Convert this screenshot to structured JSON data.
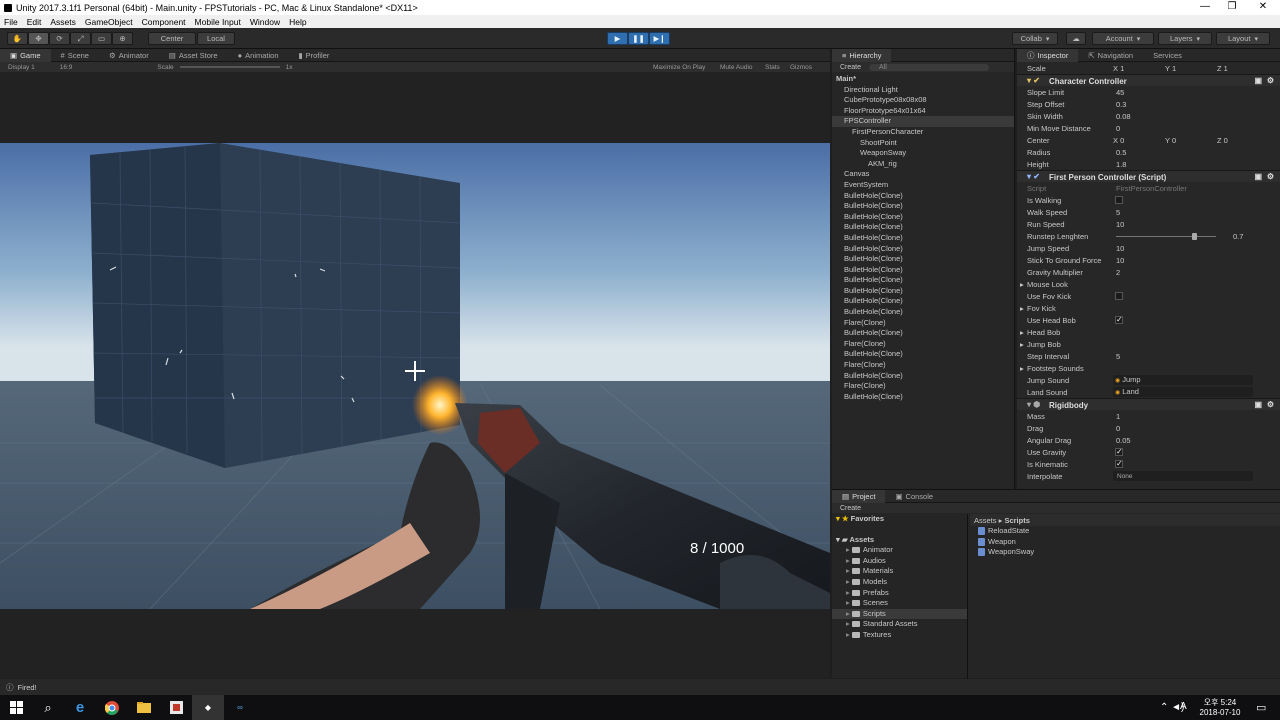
{
  "window": {
    "title": "Unity 2017.3.1f1 Personal (64bit) - Main.unity - FPSTutorials - PC, Mac & Linux Standalone* <DX11>",
    "controls": [
      "—",
      "❐",
      "✕"
    ]
  },
  "menu": [
    "File",
    "Edit",
    "Assets",
    "GameObject",
    "Component",
    "Mobile Input",
    "Window",
    "Help"
  ],
  "toolbar": {
    "pivot": "Center",
    "space": "Local",
    "collab": "Collab",
    "account": "Account",
    "layers": "Layers",
    "layout": "Layout"
  },
  "scene_tabs": [
    "Game",
    "Scene",
    "Animator",
    "Asset Store",
    "Animation",
    "Profiler"
  ],
  "gamebar": {
    "display": "Display 1",
    "aspect": "16:9",
    "scale_label": "Scale",
    "scale_value": "1x",
    "options": [
      "Maximize On Play",
      "Mute Audio",
      "Stats",
      "Gizmos"
    ]
  },
  "game": {
    "ammo": "8 / 1000"
  },
  "hierarchy": {
    "tab": "Hierarchy",
    "create": "Create",
    "search": "All",
    "items": [
      {
        "label": "Main*",
        "indent": 0,
        "bold": true
      },
      {
        "label": "Directional Light",
        "indent": 1
      },
      {
        "label": "CubePrototype08x08x08",
        "indent": 1
      },
      {
        "label": "FloorPrototype64x01x64",
        "indent": 1
      },
      {
        "label": "FPSController",
        "indent": 1,
        "selected": true
      },
      {
        "label": "FirstPersonCharacter",
        "indent": 2
      },
      {
        "label": "ShootPoint",
        "indent": 3
      },
      {
        "label": "WeaponSway",
        "indent": 3
      },
      {
        "label": "AKM_rig",
        "indent": 4
      },
      {
        "label": "Canvas",
        "indent": 1
      },
      {
        "label": "EventSystem",
        "indent": 1
      },
      {
        "label": "BulletHole(Clone)",
        "indent": 1
      },
      {
        "label": "BulletHole(Clone)",
        "indent": 1
      },
      {
        "label": "BulletHole(Clone)",
        "indent": 1
      },
      {
        "label": "BulletHole(Clone)",
        "indent": 1
      },
      {
        "label": "BulletHole(Clone)",
        "indent": 1
      },
      {
        "label": "BulletHole(Clone)",
        "indent": 1
      },
      {
        "label": "BulletHole(Clone)",
        "indent": 1
      },
      {
        "label": "BulletHole(Clone)",
        "indent": 1
      },
      {
        "label": "BulletHole(Clone)",
        "indent": 1
      },
      {
        "label": "BulletHole(Clone)",
        "indent": 1
      },
      {
        "label": "BulletHole(Clone)",
        "indent": 1
      },
      {
        "label": "BulletHole(Clone)",
        "indent": 1
      },
      {
        "label": "Flare(Clone)",
        "indent": 1
      },
      {
        "label": "BulletHole(Clone)",
        "indent": 1
      },
      {
        "label": "Flare(Clone)",
        "indent": 1
      },
      {
        "label": "BulletHole(Clone)",
        "indent": 1
      },
      {
        "label": "Flare(Clone)",
        "indent": 1
      },
      {
        "label": "BulletHole(Clone)",
        "indent": 1
      },
      {
        "label": "Flare(Clone)",
        "indent": 1
      },
      {
        "label": "BulletHole(Clone)",
        "indent": 1
      }
    ]
  },
  "inspector": {
    "tabs": [
      "Inspector",
      "Navigation",
      "Services"
    ],
    "scale": {
      "label": "Scale",
      "x": "1",
      "y": "1",
      "z": "1"
    },
    "character_controller": {
      "title": "Character Controller",
      "rows": [
        {
          "label": "Slope Limit",
          "value": "45"
        },
        {
          "label": "Step Offset",
          "value": "0.3"
        },
        {
          "label": "Skin Width",
          "value": "0.08"
        },
        {
          "label": "Min Move Distance",
          "value": "0"
        }
      ],
      "center": {
        "label": "Center",
        "x": "0",
        "y": "0",
        "z": "0"
      },
      "rows2": [
        {
          "label": "Radius",
          "value": "0.5"
        },
        {
          "label": "Height",
          "value": "1.8"
        }
      ]
    },
    "fpc": {
      "title": "First Person Controller (Script)",
      "script_label": "Script",
      "script_value": "FirstPersonController",
      "rows": [
        {
          "label": "Is Walking",
          "type": "check",
          "checked": false
        },
        {
          "label": "Walk Speed",
          "value": "5"
        },
        {
          "label": "Run Speed",
          "value": "10"
        },
        {
          "label": "Runstep Lenghten",
          "value": "0.7",
          "type": "slider"
        },
        {
          "label": "Jump Speed",
          "value": "10"
        },
        {
          "label": "Stick To Ground Force",
          "value": "10"
        },
        {
          "label": "Gravity Multiplier",
          "value": "2"
        },
        {
          "label": "Mouse Look",
          "type": "fold"
        },
        {
          "label": "Use Fov Kick",
          "type": "check",
          "checked": false
        },
        {
          "label": "Fov Kick",
          "type": "fold"
        },
        {
          "label": "Use Head Bob",
          "type": "check",
          "checked": true
        },
        {
          "label": "Head Bob",
          "type": "fold"
        },
        {
          "label": "Jump Bob",
          "type": "fold"
        },
        {
          "label": "Step Interval",
          "value": "5"
        },
        {
          "label": "Footstep Sounds",
          "type": "fold"
        },
        {
          "label": "Jump Sound",
          "value": "Jump",
          "type": "object"
        },
        {
          "label": "Land Sound",
          "value": "Land",
          "type": "object"
        }
      ]
    },
    "rigidbody": {
      "title": "Rigidbody",
      "rows": [
        {
          "label": "Mass",
          "value": "1"
        },
        {
          "label": "Drag",
          "value": "0"
        },
        {
          "label": "Angular Drag",
          "value": "0.05"
        },
        {
          "label": "Use Gravity",
          "type": "check",
          "checked": true
        },
        {
          "label": "Is Kinematic",
          "type": "check",
          "checked": true
        },
        {
          "label": "Interpolate",
          "value": "None",
          "type": "dropdown"
        }
      ]
    }
  },
  "project": {
    "tabs": [
      "Project",
      "Console"
    ],
    "create": "Create",
    "favorites": "Favorites",
    "assets": "Assets",
    "folders": [
      "Animator",
      "Audios",
      "Materials",
      "Models",
      "Prefabs",
      "Scenes",
      "Scripts",
      "Standard Assets",
      "Textures"
    ],
    "selected_folder": "Scripts",
    "breadcrumb": [
      "Assets",
      "Scripts"
    ],
    "files": [
      "ReloadState",
      "Weapon",
      "WeaponSway"
    ]
  },
  "status": {
    "message": "Fired!"
  },
  "taskbar": {
    "time": "오후 5:24",
    "date": "2018-07-10",
    "ime": "A"
  },
  "colors": {
    "accent": "#2f6fb0",
    "editor_bg": "#222222",
    "sky_top": "#4a6ea6",
    "sky_horizon": "#d9e3ea",
    "ground": "#3d4f62"
  }
}
